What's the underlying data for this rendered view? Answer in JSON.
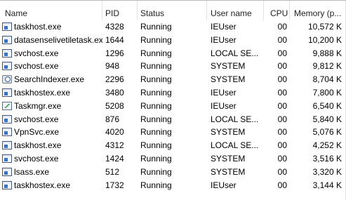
{
  "columns": {
    "name": "Name",
    "pid": "PID",
    "status": "Status",
    "user": "User name",
    "cpu": "CPU",
    "memory": "Memory (p..."
  },
  "processes": [
    {
      "name": "taskhost.exe",
      "icon": "window-icon",
      "pid": "4328",
      "status": "Running",
      "user": "IEUser",
      "cpu": "00",
      "memory": "10,572 K"
    },
    {
      "name": "datasenselivetiletask.exe",
      "icon": "window-icon",
      "pid": "1644",
      "status": "Running",
      "user": "IEUser",
      "cpu": "00",
      "memory": "10,200 K"
    },
    {
      "name": "svchost.exe",
      "icon": "window-icon",
      "pid": "1296",
      "status": "Running",
      "user": "LOCAL SE...",
      "cpu": "00",
      "memory": "9,888 K"
    },
    {
      "name": "svchost.exe",
      "icon": "window-icon",
      "pid": "948",
      "status": "Running",
      "user": "SYSTEM",
      "cpu": "00",
      "memory": "9,812 K"
    },
    {
      "name": "SearchIndexer.exe",
      "icon": "search-icon",
      "pid": "2296",
      "status": "Running",
      "user": "SYSTEM",
      "cpu": "00",
      "memory": "8,704 K"
    },
    {
      "name": "taskhostex.exe",
      "icon": "window-icon",
      "pid": "3480",
      "status": "Running",
      "user": "IEUser",
      "cpu": "00",
      "memory": "7,800 K"
    },
    {
      "name": "Taskmgr.exe",
      "icon": "task-manager-icon",
      "pid": "5208",
      "status": "Running",
      "user": "IEUser",
      "cpu": "00",
      "memory": "6,540 K"
    },
    {
      "name": "svchost.exe",
      "icon": "window-icon",
      "pid": "876",
      "status": "Running",
      "user": "LOCAL SE...",
      "cpu": "00",
      "memory": "5,840 K"
    },
    {
      "name": "VpnSvc.exe",
      "icon": "window-icon",
      "pid": "4020",
      "status": "Running",
      "user": "SYSTEM",
      "cpu": "00",
      "memory": "5,076 K"
    },
    {
      "name": "taskhost.exe",
      "icon": "window-icon",
      "pid": "4312",
      "status": "Running",
      "user": "LOCAL SE...",
      "cpu": "00",
      "memory": "4,252 K"
    },
    {
      "name": "svchost.exe",
      "icon": "window-icon",
      "pid": "1424",
      "status": "Running",
      "user": "SYSTEM",
      "cpu": "00",
      "memory": "3,516 K"
    },
    {
      "name": "lsass.exe",
      "icon": "window-icon",
      "pid": "512",
      "status": "Running",
      "user": "SYSTEM",
      "cpu": "00",
      "memory": "3,320 K"
    },
    {
      "name": "taskhostex.exe",
      "icon": "window-icon",
      "pid": "1732",
      "status": "Running",
      "user": "IEUser",
      "cpu": "00",
      "memory": "3,144 K"
    }
  ]
}
